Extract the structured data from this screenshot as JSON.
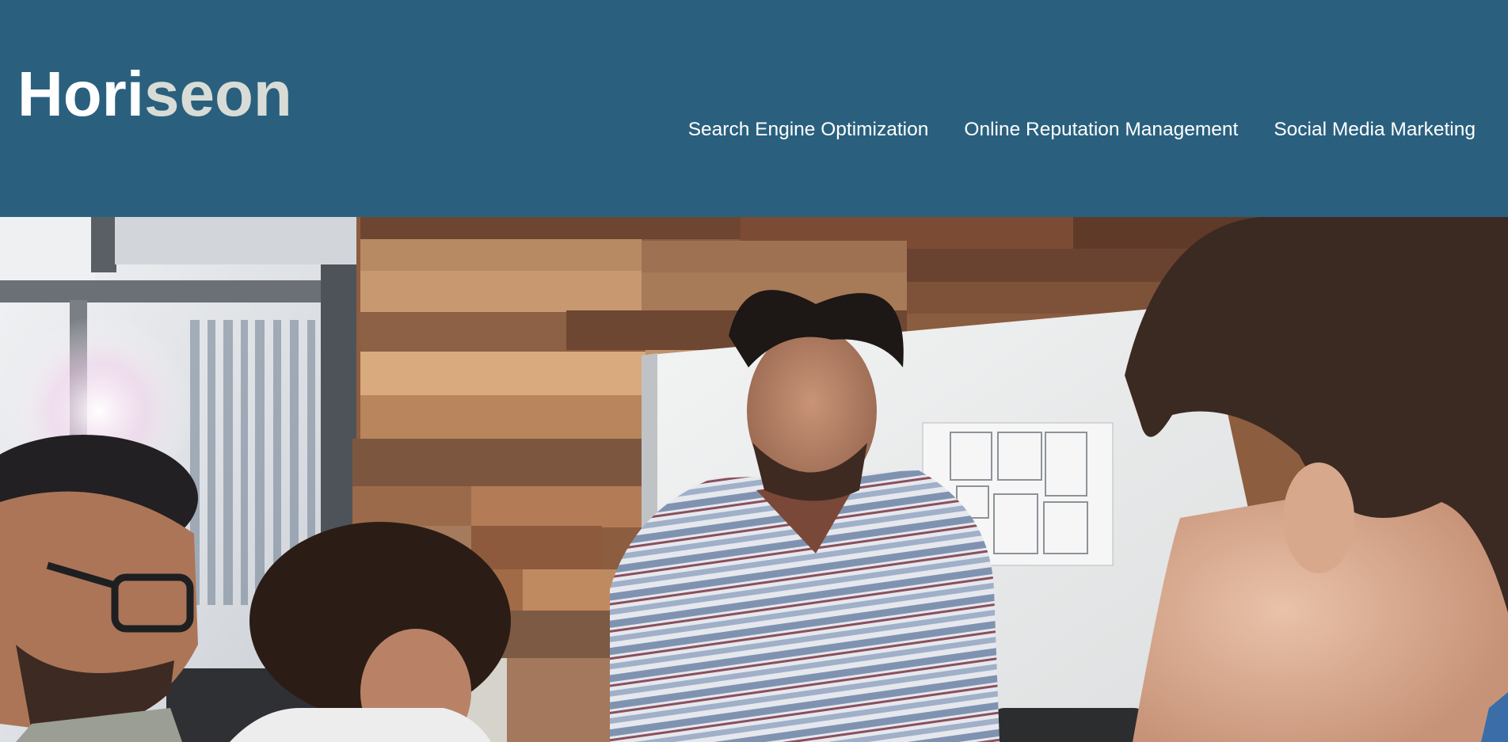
{
  "header": {
    "brand": {
      "part_a": "Hori",
      "part_b": "seon"
    },
    "nav": [
      {
        "label": "Search Engine Optimization"
      },
      {
        "label": "Online Reputation Management"
      },
      {
        "label": "Social Media Marketing"
      }
    ]
  },
  "hero": {
    "image": "team-meeting-photo"
  },
  "colors": {
    "header_background": "#2a607e",
    "brand_primary": "#ffffff",
    "brand_secondary": "#d9dcd6",
    "nav_text": "#ffffff"
  }
}
